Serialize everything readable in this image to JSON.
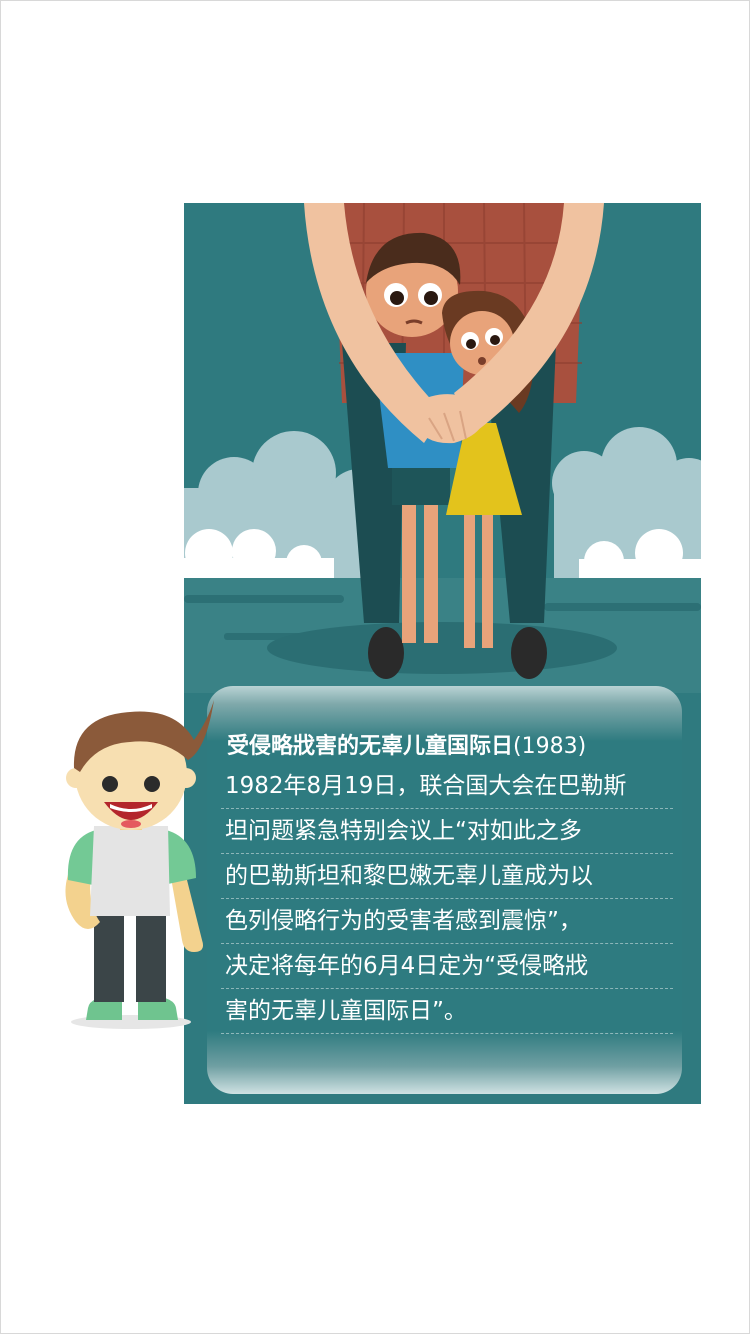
{
  "infographic": {
    "title": "受侵略戕害的无辜儿童国际日",
    "year": "(1983)",
    "body_lines": [
      "1982年8月19日，联合国大会在巴勒斯",
      "坦问题紧急特别会议上“对如此之多",
      "的巴勒斯坦和黎巴嫩无辜儿童成为以",
      "色列侵略行为的受害者感到震惊”，",
      "决定将每年的6月4日定为“受侵略戕",
      "害的无辜儿童国际日”。"
    ]
  },
  "colors": {
    "card_background": "#2f7a7f",
    "cloud": "#a9c9ce",
    "text": "#ffffff"
  },
  "illustrations": {
    "scene": "adult-protecting-children-illustration",
    "mascot": "cartoon-boy-mascot"
  }
}
